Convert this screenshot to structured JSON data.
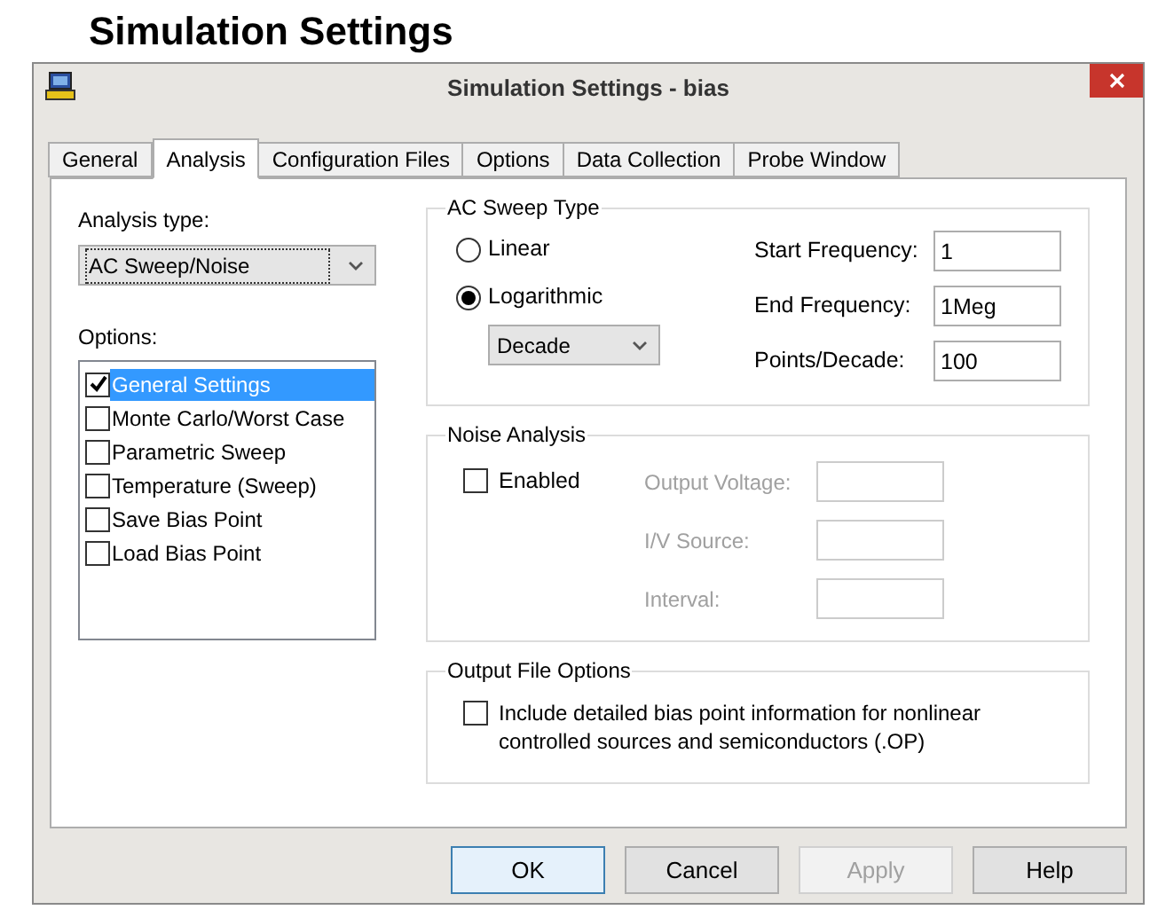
{
  "heading": "Simulation Settings",
  "window": {
    "title": "Simulation Settings - bias"
  },
  "tabs": [
    {
      "label": "General",
      "selected": false
    },
    {
      "label": "Analysis",
      "selected": true
    },
    {
      "label": "Configuration Files",
      "selected": false
    },
    {
      "label": "Options",
      "selected": false
    },
    {
      "label": "Data Collection",
      "selected": false
    },
    {
      "label": "Probe Window",
      "selected": false
    }
  ],
  "analysis_type": {
    "label": "Analysis type:",
    "value": "AC Sweep/Noise"
  },
  "options": {
    "label": "Options:",
    "items": [
      {
        "label": "General Settings",
        "checked": true,
        "selected": true
      },
      {
        "label": "Monte Carlo/Worst Case",
        "checked": false,
        "selected": false
      },
      {
        "label": "Parametric Sweep",
        "checked": false,
        "selected": false
      },
      {
        "label": "Temperature (Sweep)",
        "checked": false,
        "selected": false
      },
      {
        "label": "Save Bias Point",
        "checked": false,
        "selected": false
      },
      {
        "label": "Load Bias Point",
        "checked": false,
        "selected": false
      }
    ]
  },
  "ac_sweep": {
    "title": "AC Sweep Type",
    "radios": [
      {
        "label": "Linear",
        "selected": false
      },
      {
        "label": "Logarithmic",
        "selected": true
      }
    ],
    "scale": "Decade",
    "fields": [
      {
        "label": "Start Frequency:",
        "value": "1"
      },
      {
        "label": "End Frequency:",
        "value": "1Meg"
      },
      {
        "label": "Points/Decade:",
        "value": "100"
      }
    ]
  },
  "noise": {
    "title": "Noise Analysis",
    "enabled": {
      "label": "Enabled",
      "checked": false
    },
    "fields": [
      {
        "label": "Output Voltage:",
        "disabled": true
      },
      {
        "label": "I/V Source:",
        "disabled": true
      },
      {
        "label": "Interval:",
        "disabled": true
      }
    ]
  },
  "output_file": {
    "title": "Output File Options",
    "checkbox": {
      "label": "Include detailed bias point information for nonlinear controlled sources and semiconductors (.OP)",
      "checked": false
    }
  },
  "buttons": [
    {
      "label": "OK",
      "disabled": false,
      "default": true
    },
    {
      "label": "Cancel",
      "disabled": false,
      "default": false
    },
    {
      "label": "Apply",
      "disabled": true,
      "default": false
    },
    {
      "label": "Help",
      "disabled": false,
      "default": false
    }
  ]
}
